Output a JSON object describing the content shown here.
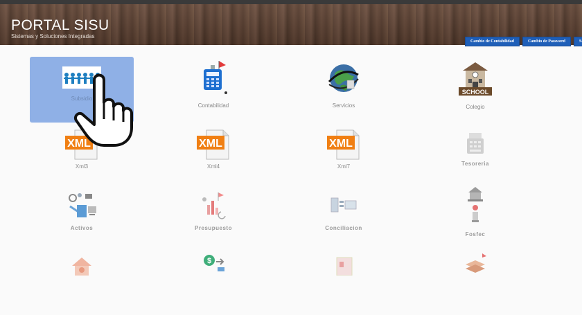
{
  "header": {
    "title": "PORTAL SISU",
    "subtitle": "Sistemas y Soluciones Integradas",
    "nav": [
      "Cambio de Contabilidad",
      "Cambio de Password",
      "Sal"
    ]
  },
  "modules": [
    {
      "label": "Subsidio",
      "icon": "people-group-icon"
    },
    {
      "label": "Contabilidad",
      "icon": "calculator-icon"
    },
    {
      "label": "Servicios",
      "icon": "globe-icon"
    },
    {
      "label": "Colegio",
      "icon": "school-icon"
    },
    {
      "label": "Xml3",
      "icon": "xml-file-icon"
    },
    {
      "label": "Xml4",
      "icon": "xml-file-icon"
    },
    {
      "label": "Xml7",
      "icon": "xml-file-icon"
    },
    {
      "label": "Tesoreria",
      "icon": "register-icon"
    },
    {
      "label": "Activos",
      "icon": "assets-icon"
    },
    {
      "label": "Presupuesto",
      "icon": "budget-chart-icon"
    },
    {
      "label": "Conciliacion",
      "icon": "reconciliation-icon"
    },
    {
      "label": "Fosfec",
      "icon": "fosfec-icon"
    }
  ],
  "ui": {
    "accent": "#1f5fb8",
    "selected": "#8fb0e6",
    "cursor_icon": "hand-pointer-icon"
  }
}
